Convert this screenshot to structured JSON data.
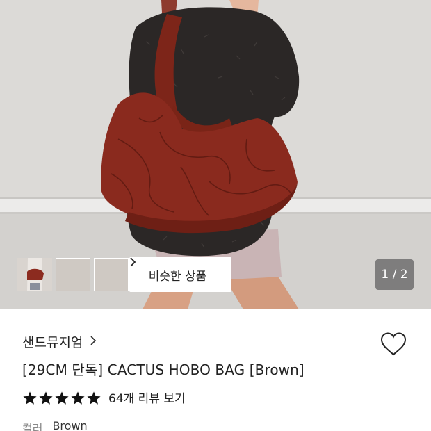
{
  "gallery": {
    "counter": "1 / 2",
    "similar_label": "비슷한 상품",
    "thumbnail_count": 3
  },
  "product": {
    "brand": "샌드뮤지엄",
    "title": "[29CM 단독] CACTUS HOBO BAG [Brown]",
    "rating_stars": 5,
    "review_link": "64개 리뷰 보기",
    "option_label": "컬러",
    "option_value": "Brown"
  },
  "icons": {
    "brand_chevron": "chevron-right-icon",
    "similar_chevron": "chevron-right-icon",
    "wishlist": "heart-outline-icon",
    "star": "star-filled-icon"
  },
  "colors": {
    "bag": "#8a2a1e",
    "sweater": "#2b2726",
    "wall": "#dcdad7",
    "shorts": "#c9b4b5",
    "text": "#222222"
  }
}
